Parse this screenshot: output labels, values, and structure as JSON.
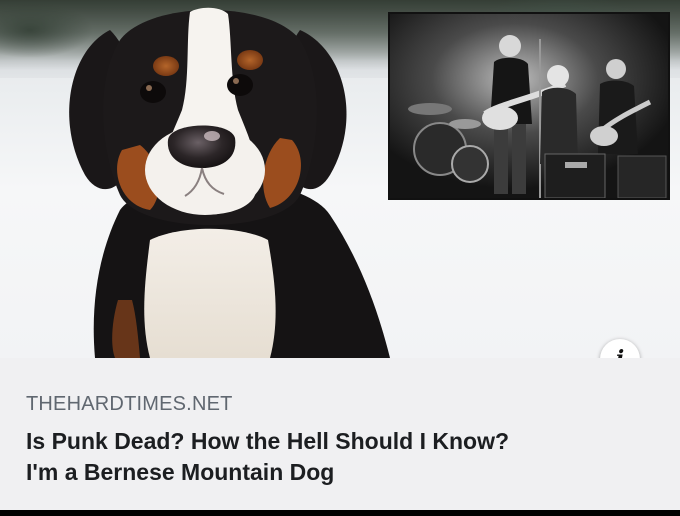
{
  "link_preview": {
    "domain": "THEHARDTIMES.NET",
    "headline_line1": "Is Punk Dead? How the Hell Should I Know?",
    "headline_line2": "I'm a Bernese Mountain Dog",
    "info_icon": "info-icon",
    "info_glyph": "i"
  },
  "image": {
    "subject": "bernese-mountain-dog-in-snow",
    "inset": "black-and-white-punk-band-on-stage"
  }
}
